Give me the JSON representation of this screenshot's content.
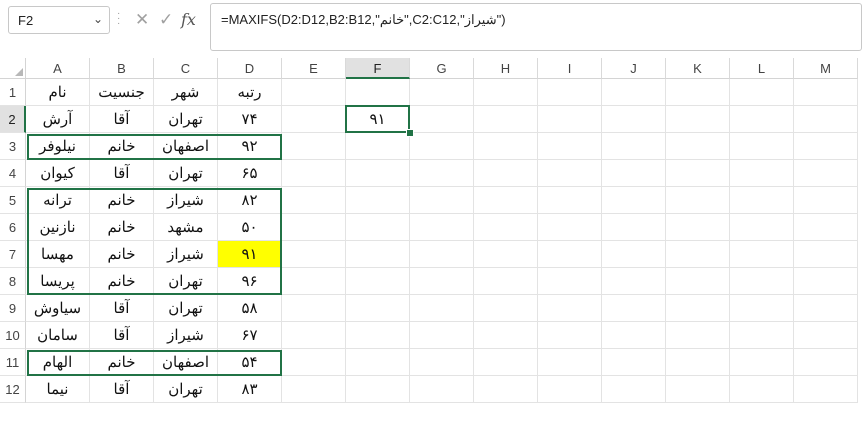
{
  "name_box": {
    "value": "F2"
  },
  "formula_bar": {
    "formula": "=MAXIFS(D2:D12,B2:B12,\"خانم\",C2:C12,\"شیراز\")"
  },
  "icons": {
    "cancel": "✕",
    "enter": "✓",
    "fx": "fx"
  },
  "columns": [
    "A",
    "B",
    "C",
    "D",
    "E",
    "F",
    "G",
    "H",
    "I",
    "J",
    "K",
    "L",
    "M"
  ],
  "selected_column": "F",
  "selected_row": "2",
  "rows": [
    "1",
    "2",
    "3",
    "4",
    "5",
    "6",
    "7",
    "8",
    "9",
    "10",
    "11",
    "12"
  ],
  "table": {
    "header": [
      "نام",
      "جنسیت",
      "شهر",
      "رتبه"
    ],
    "data": [
      [
        "آرش",
        "آقا",
        "تهران",
        "۷۴"
      ],
      [
        "نیلوفر",
        "خانم",
        "اصفهان",
        "۹۲"
      ],
      [
        "کیوان",
        "آقا",
        "تهران",
        "۶۵"
      ],
      [
        "ترانه",
        "خانم",
        "شیراز",
        "۸۲"
      ],
      [
        "نازنین",
        "خانم",
        "مشهد",
        "۵۰"
      ],
      [
        "مهسا",
        "خانم",
        "شیراز",
        "۹۱"
      ],
      [
        "پریسا",
        "خانم",
        "تهران",
        "۹۶"
      ],
      [
        "سیاوش",
        "آقا",
        "تهران",
        "۵۸"
      ],
      [
        "سامان",
        "آقا",
        "شیراز",
        "۶۷"
      ],
      [
        "الهام",
        "خانم",
        "اصفهان",
        "۵۴"
      ],
      [
        "نیما",
        "آقا",
        "تهران",
        "۸۳"
      ]
    ]
  },
  "result_cell": {
    "address": "F2",
    "value": "۹۱"
  },
  "highlight": {
    "cell": "D7",
    "color": "#ffff00"
  },
  "accent_color": "#217346"
}
